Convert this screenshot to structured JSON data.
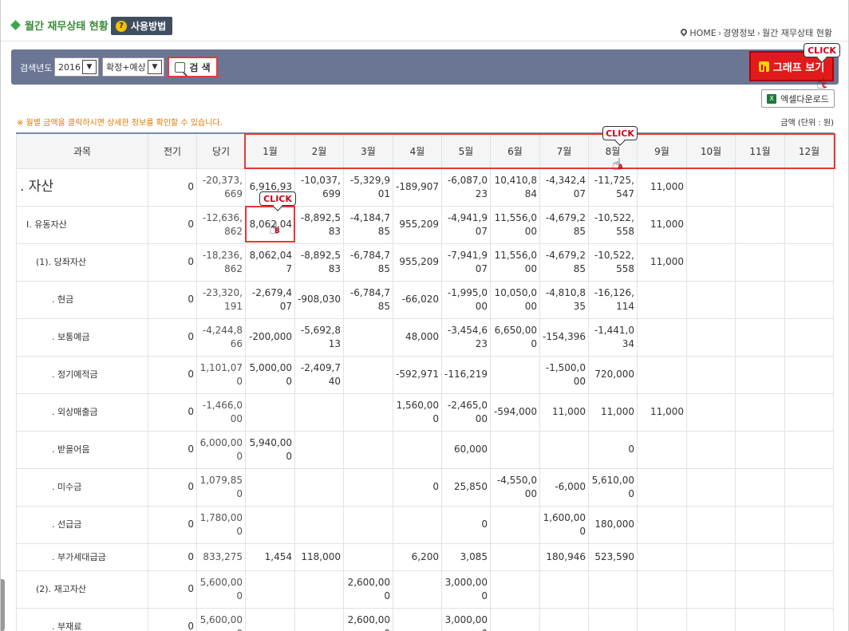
{
  "header": {
    "title": "월간 재무상태 현황",
    "help_label": "사용방법",
    "breadcrumb": [
      "HOME",
      "경영정보",
      "월간 재무상태 현황"
    ]
  },
  "search": {
    "year_label": "검색년도 :",
    "year_value": "2016",
    "type_value": "확정+예상",
    "search_label": "검 색",
    "graph_label": "그래프 보기",
    "excel_label": "엑셀다운로드"
  },
  "callouts": {
    "graph": "CLICK",
    "month": "CLICK",
    "cell": "CLICK",
    "marker_a": "A",
    "marker_b": "B",
    "marker_c": "C"
  },
  "notice": "※ 월별 금액을 클릭하시면 상세한 정보를 확인할 수 있습니다.",
  "unit": "금액  (단위 : 원)",
  "table": {
    "headers": [
      "과목",
      "전기",
      "당기",
      "1월",
      "2월",
      "3월",
      "4월",
      "5월",
      "6월",
      "7월",
      "8월",
      "9월",
      "10월",
      "11월",
      "12월"
    ],
    "rows": [
      {
        "level": 0,
        "cells": [
          ". 자산",
          "0",
          "-20,373,669",
          "6,916,93",
          "-10,037,699",
          "-5,329,901",
          "-189,907",
          "-6,087,023",
          "10,410,884",
          "-4,342,407",
          "-11,725,547",
          "11,000",
          "",
          "",
          ""
        ]
      },
      {
        "level": 1,
        "cells": [
          "Ⅰ. 유동자산",
          "0",
          "-12,636,862",
          "8,062,04",
          "-8,892,583",
          "-4,184,785",
          "955,209",
          "-4,941,907",
          "11,556,000",
          "-4,679,285",
          "-10,522,558",
          "11,000",
          "",
          "",
          ""
        ]
      },
      {
        "level": 2,
        "cells": [
          "(1). 당좌자산",
          "0",
          "-18,236,862",
          "8,062,047",
          "-8,892,583",
          "-6,784,785",
          "955,209",
          "-7,941,907",
          "11,556,000",
          "-4,679,285",
          "-10,522,558",
          "11,000",
          "",
          "",
          ""
        ]
      },
      {
        "level": 3,
        "cells": [
          ". 현금",
          "0",
          "-23,320,191",
          "-2,679,407",
          "-908,030",
          "-6,784,785",
          "-66,020",
          "-1,995,000",
          "10,050,000",
          "-4,810,835",
          "-16,126,114",
          "",
          "",
          "",
          ""
        ]
      },
      {
        "level": 3,
        "cells": [
          ". 보통예금",
          "0",
          "-4,244,866",
          "-200,000",
          "-5,692,813",
          "",
          "48,000",
          "-3,454,623",
          "6,650,000",
          "-154,396",
          "-1,441,034",
          "",
          "",
          "",
          ""
        ]
      },
      {
        "level": 3,
        "cells": [
          ". 정기예적금",
          "0",
          "1,101,070",
          "5,000,000",
          "-2,409,740",
          "",
          "-592,971",
          "-116,219",
          "",
          "-1,500,000",
          "720,000",
          "",
          "",
          "",
          ""
        ]
      },
      {
        "level": 3,
        "cells": [
          ". 외상매출금",
          "0",
          "-1,466,000",
          "",
          "",
          "",
          "1,560,000",
          "-2,465,000",
          "-594,000",
          "11,000",
          "11,000",
          "11,000",
          "",
          "",
          ""
        ]
      },
      {
        "level": 3,
        "cells": [
          ". 받을어음",
          "0",
          "6,000,000",
          "5,940,000",
          "",
          "",
          "",
          "60,000",
          "",
          "",
          "0",
          "",
          "",
          "",
          ""
        ]
      },
      {
        "level": 3,
        "cells": [
          ". 미수금",
          "0",
          "1,079,850",
          "",
          "",
          "",
          "0",
          "25,850",
          "-4,550,000",
          "-6,000",
          "5,610,000",
          "",
          "",
          "",
          ""
        ]
      },
      {
        "level": 3,
        "cells": [
          ". 선급금",
          "0",
          "1,780,000",
          "",
          "",
          "",
          "",
          "0",
          "",
          "1,600,000",
          "180,000",
          "",
          "",
          "",
          ""
        ]
      },
      {
        "level": 3,
        "short": true,
        "cells": [
          ". 부가세대급금",
          "0",
          "833,275",
          "1,454",
          "118,000",
          "",
          "6,200",
          "3,085",
          "",
          "180,946",
          "523,590",
          "",
          "",
          "",
          ""
        ]
      },
      {
        "level": 2,
        "cells": [
          "(2). 재고자산",
          "0",
          "5,600,000",
          "",
          "",
          "2,600,000",
          "",
          "3,000,000",
          "",
          "",
          "",
          "",
          "",
          "",
          ""
        ]
      },
      {
        "level": 3,
        "cells": [
          ". 부재료",
          "0",
          "5,600,000",
          "",
          "",
          "2,600,000",
          "",
          "3,000,000",
          "",
          "",
          "",
          "",
          "",
          "",
          ""
        ]
      }
    ]
  },
  "colors": {
    "accent_red": "#e53935",
    "search_bar": "#6b7594",
    "title_green": "#3a8a3a"
  }
}
